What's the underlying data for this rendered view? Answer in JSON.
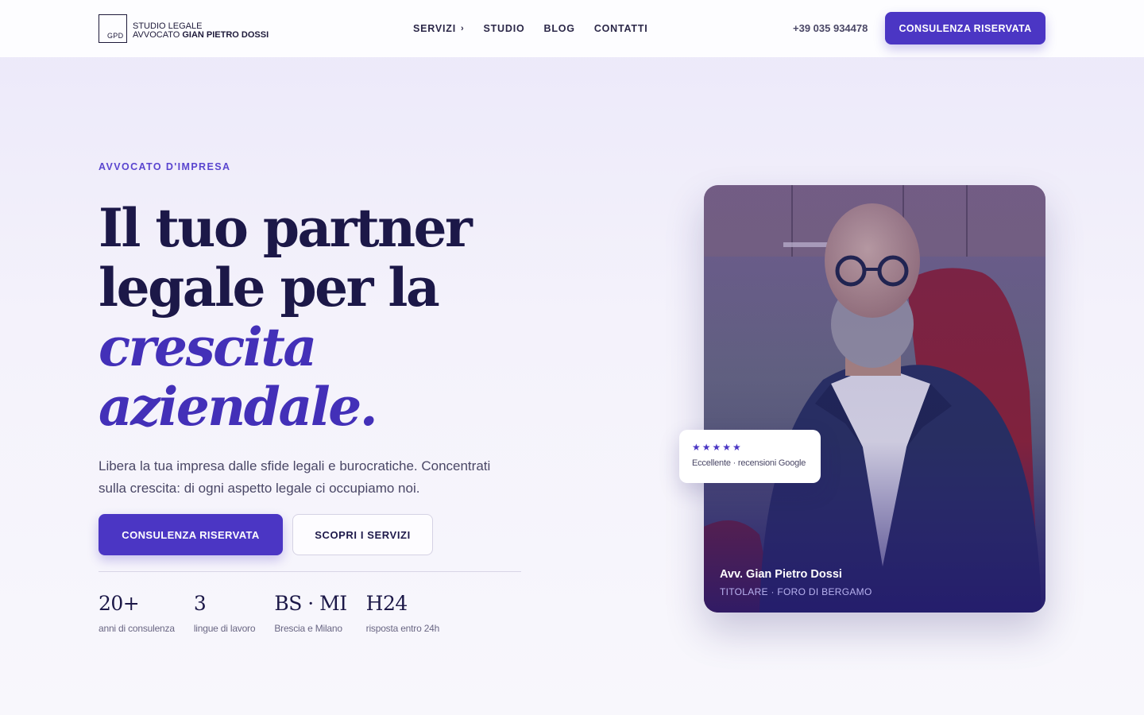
{
  "header": {
    "logo_mark": "GPD",
    "logo_line1": "STUDIO LEGALE",
    "logo_line2_prefix": "AVVOCATO",
    "logo_line2_name": "GIAN PIETRO DOSSI",
    "nav": [
      {
        "label": "SERVIZI",
        "has_submenu": true
      },
      {
        "label": "STUDIO"
      },
      {
        "label": "BLOG"
      },
      {
        "label": "CONTATTI"
      }
    ],
    "phone": "+39 035 934478",
    "cta_label": "CONSULENZA RISERVATA"
  },
  "hero": {
    "eyebrow": "AVVOCATO D'IMPRESA",
    "headline_line1": "Il tuo partner",
    "headline_line2": "legale per la",
    "headline_italic1": "crescita",
    "headline_italic2": "aziendale.",
    "lead": "Libera la tua impresa dalle sfide legali e burocratiche. Concentrati sulla crescita: di ogni aspetto legale ci occupiamo noi.",
    "primary_cta": "CONSULENZA RISERVATA",
    "secondary_cta": "SCOPRI I SERVIZI",
    "stats": [
      {
        "value": "20+",
        "label": "anni di consulenza"
      },
      {
        "value": "3",
        "label": "lingue di lavoro"
      },
      {
        "value": "BS · MI",
        "label": "Brescia e Milano"
      },
      {
        "value": "H24",
        "label": "risposta entro 24h"
      }
    ]
  },
  "photo_card": {
    "name": "Avv. Gian Pietro Dossi",
    "role": "TITOLARE · FORO DI BERGAMO"
  },
  "review_badge": {
    "stars": "★★★★★",
    "rating_value": 5,
    "text": "Eccellente · recensioni Google"
  },
  "colors": {
    "accent": "#4b36c4",
    "heading": "#1c1848",
    "italic_heading": "#4330b8",
    "eyebrow": "#5a45cf"
  },
  "icons": [
    "chevron-right-icon",
    "star-icon"
  ]
}
